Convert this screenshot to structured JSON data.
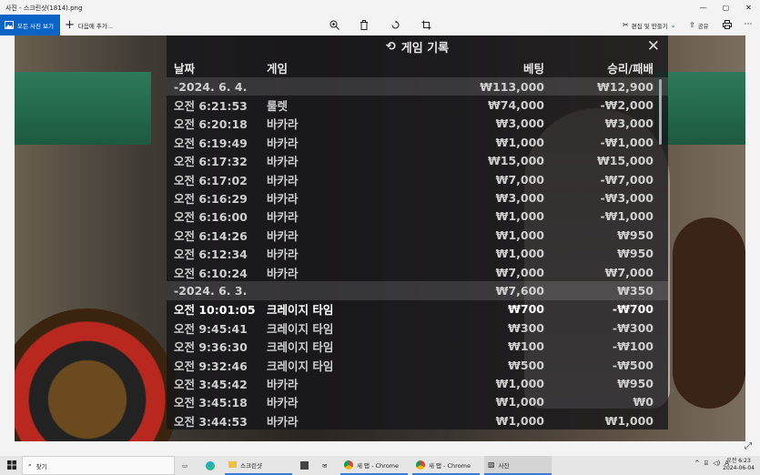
{
  "window": {
    "title": "사진 - 스크린샷(1814).png",
    "buttons": [
      "—",
      "▢",
      "✕"
    ]
  },
  "toolbar": {
    "all_photos": "모든 사진 보기",
    "add_to": "다음에 추가...",
    "edit_create": "편집 및 만들기",
    "share": "공유"
  },
  "panel": {
    "title": "게임 기록",
    "close": "✕",
    "headers": {
      "date": "날짜",
      "game": "게임",
      "bet": "베팅",
      "winloss": "승리/패배"
    },
    "groups": [
      {
        "date": "-2024. 6. 4.",
        "bet": "₩113,000",
        "winloss": "₩12,900",
        "rows": [
          {
            "time": "오전 6:21:53",
            "game": "룰렛",
            "bet": "₩74,000",
            "winloss": "-₩2,000"
          },
          {
            "time": "오전 6:20:18",
            "game": "바카라",
            "bet": "₩3,000",
            "winloss": "₩3,000"
          },
          {
            "time": "오전 6:19:49",
            "game": "바카라",
            "bet": "₩1,000",
            "winloss": "-₩1,000"
          },
          {
            "time": "오전 6:17:32",
            "game": "바카라",
            "bet": "₩15,000",
            "winloss": "₩15,000"
          },
          {
            "time": "오전 6:17:02",
            "game": "바카라",
            "bet": "₩7,000",
            "winloss": "-₩7,000"
          },
          {
            "time": "오전 6:16:29",
            "game": "바카라",
            "bet": "₩3,000",
            "winloss": "-₩3,000"
          },
          {
            "time": "오전 6:16:00",
            "game": "바카라",
            "bet": "₩1,000",
            "winloss": "-₩1,000"
          },
          {
            "time": "오전 6:14:26",
            "game": "바카라",
            "bet": "₩1,000",
            "winloss": "₩950"
          },
          {
            "time": "오전 6:12:34",
            "game": "바카라",
            "bet": "₩1,000",
            "winloss": "₩950"
          },
          {
            "time": "오전 6:10:24",
            "game": "바카라",
            "bet": "₩7,000",
            "winloss": "₩7,000"
          }
        ]
      },
      {
        "date": "-2024. 6. 3.",
        "bet": "₩7,600",
        "winloss": "₩350",
        "rows": [
          {
            "time": "오전 10:01:05",
            "game": "크레이지 타임",
            "bet": "₩700",
            "winloss": "-₩700"
          },
          {
            "time": "오전 9:45:41",
            "game": "크레이지 타임",
            "bet": "₩300",
            "winloss": "-₩300"
          },
          {
            "time": "오전 9:36:30",
            "game": "크레이지 타임",
            "bet": "₩100",
            "winloss": "-₩100"
          },
          {
            "time": "오전 9:32:46",
            "game": "크레이지 타임",
            "bet": "₩500",
            "winloss": "-₩500"
          },
          {
            "time": "오전 3:45:42",
            "game": "바카라",
            "bet": "₩1,000",
            "winloss": "₩950"
          },
          {
            "time": "오전 3:45:18",
            "game": "바카라",
            "bet": "₩1,000",
            "winloss": "₩0"
          },
          {
            "time": "오전 3:44:53",
            "game": "바카라",
            "bet": "₩1,000",
            "winloss": "₩1,000"
          }
        ]
      }
    ]
  },
  "taskbar": {
    "search": "찾기",
    "apps": [
      "스크린샷",
      "새 탭 - Chrome",
      "새 탭 - Chrome",
      "사진"
    ],
    "tray_lang": "A",
    "time": "오전 6:23",
    "date": "2024-06-04"
  }
}
